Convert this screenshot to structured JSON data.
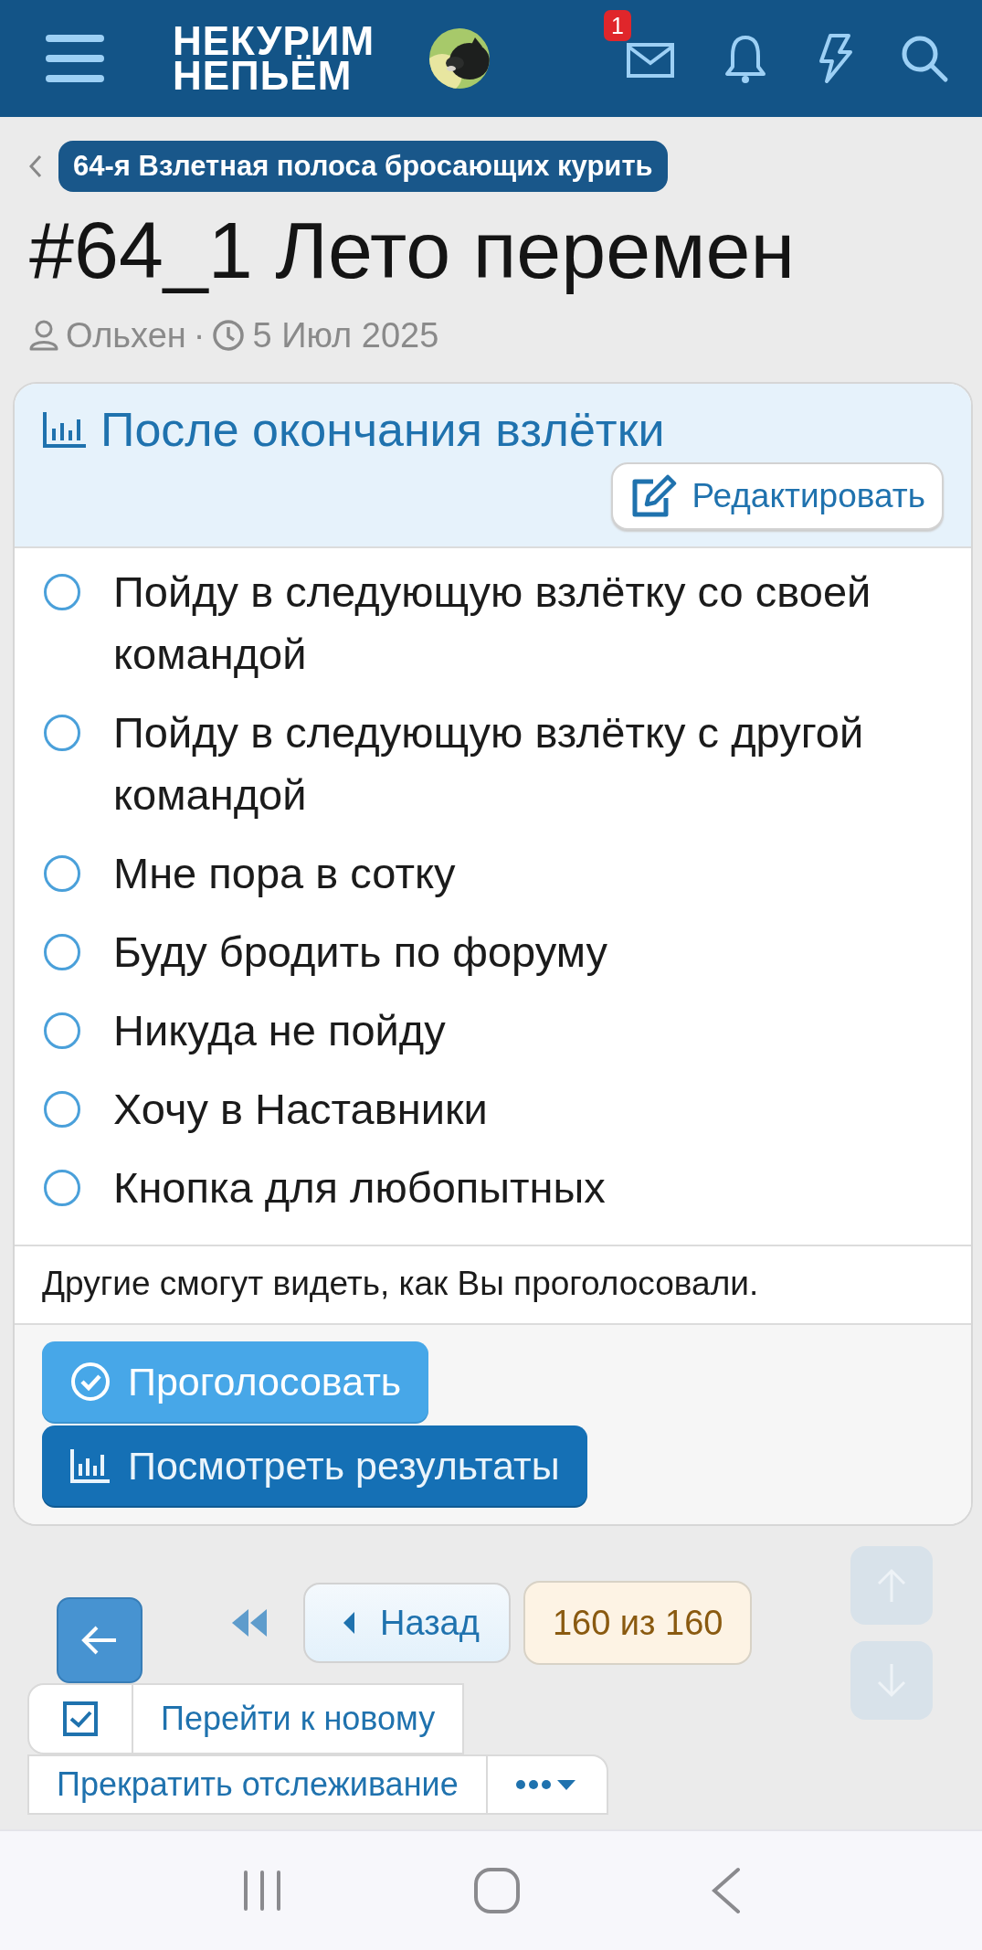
{
  "header": {
    "logo_lines": [
      "НЕКУРИМ",
      "НЕПЬЁМ"
    ],
    "inbox_badge": "1"
  },
  "breadcrumb": "64-я Взлетная полоса бросающих курить",
  "title": "#64_1 Лето перемен",
  "meta": {
    "author": "Ольхен",
    "separator": "·",
    "date": "5 Июл 2025"
  },
  "poll": {
    "title": "После окончания взлётки",
    "edit_button": "Редактировать",
    "options": [
      {
        "label": "Пойду в следующую взлётку со своей командой",
        "selected": false
      },
      {
        "label": "Пойду в следующую взлётку с другой командой",
        "selected": false
      },
      {
        "label": "Мне пора в сотку",
        "selected": false
      },
      {
        "label": "Буду бродить по форуму",
        "selected": false
      },
      {
        "label": "Никуда не пойду",
        "selected": false
      },
      {
        "label": "Хочу в Наставники",
        "selected": false
      },
      {
        "label": "Кнопка для любопытных",
        "selected": false
      }
    ],
    "note": "Другие смогут видеть, как Вы проголосовали.",
    "vote_button": "Проголосовать",
    "results_button": "Посмотреть результаты"
  },
  "pagination": {
    "prev": "Назад",
    "counter": "160 из 160"
  },
  "actions": [
    {
      "kind": "watch-new",
      "label": "Перейти к новому",
      "checked": true
    },
    {
      "kind": "menu",
      "label": "Прекратить отслеживание"
    }
  ]
}
